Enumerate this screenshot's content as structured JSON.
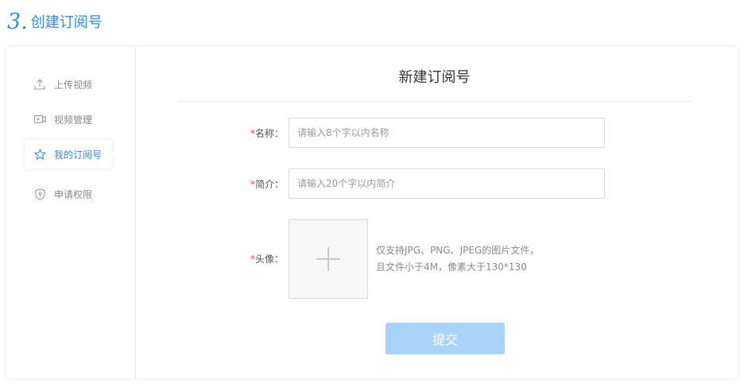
{
  "step": {
    "number": "3.",
    "title": "创建订阅号"
  },
  "sidebar": {
    "items": [
      {
        "label": "上传视频",
        "icon": "upload-icon",
        "active": false
      },
      {
        "label": "视频管理",
        "icon": "video-icon",
        "active": false
      },
      {
        "label": "我的订阅号",
        "icon": "star-icon",
        "active": true
      },
      {
        "label": "申请权限",
        "icon": "shield-icon",
        "active": false
      }
    ]
  },
  "form": {
    "title": "新建订阅号",
    "name": {
      "required_mark": "*",
      "label": "名称：",
      "placeholder": "请输入8个字以内名称",
      "value": ""
    },
    "intro": {
      "required_mark": "*",
      "label": "简介：",
      "placeholder": "请输入20个字以内简介",
      "value": ""
    },
    "avatar": {
      "required_mark": "*",
      "label": "头像：",
      "hint_line1": "仅支持JPG、PNG、JPEG的图片文件，",
      "hint_line2": "且文件小于4M，像素大于130*130"
    },
    "submit_label": "提交"
  },
  "colors": {
    "accent": "#2f8de4",
    "required": "#e5483f",
    "submit_disabled": "#a9d3f8"
  }
}
